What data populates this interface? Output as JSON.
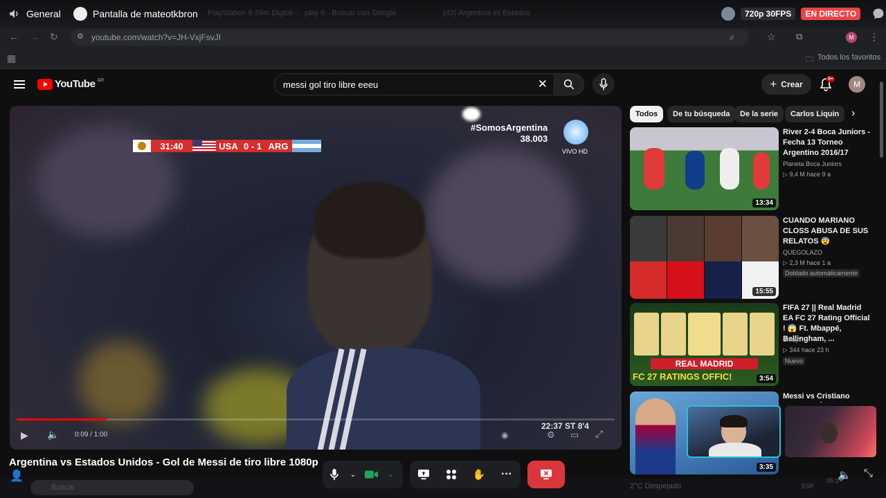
{
  "overlay": {
    "voice_channel": "General",
    "stream_title": "Pantalla de mateotkbron",
    "quality": "720p 30FPS",
    "live_label": "EN DIRECTO"
  },
  "chrome": {
    "tabs": [
      "PlayStation 5 Slim Digital -",
      "play 6 - Buscar con Google",
      "(43) Argentina vs Estados"
    ],
    "url": "youtube.com/watch?v=JH-VxjFsvJI",
    "bookmarks_label": "Todos los favoritos"
  },
  "youtube": {
    "logo": "YouTube",
    "region": "AR",
    "search_query": "messi gol tiro libre eeeu",
    "create_label": "Crear",
    "notif_count": "9+",
    "avatar_letter": "M"
  },
  "video": {
    "scorebug": {
      "time": "31:40",
      "home": "USA",
      "score": "0 - 1",
      "away": "ARG"
    },
    "hashtag": "#SomosArgentina",
    "viewers": "38.003",
    "vivo_label": "VIVO HD",
    "corner_info": "22:37 ST 8'4",
    "player_time": "0:09 / 1:00",
    "title": "Argentina vs Estados Unidos - Gol de Messi de tiro libre 1080p"
  },
  "chips": [
    {
      "label": "Todos",
      "active": true
    },
    {
      "label": "De tu búsqueda",
      "active": false
    },
    {
      "label": "De la serie",
      "active": false
    },
    {
      "label": "Carlos Liquin",
      "active": false
    }
  ],
  "recommendations": [
    {
      "title": "River 2-4 Boca Juniors - Fecha 13 Torneo Argentino 2016/17",
      "channel": "Planeta Boca Juniors",
      "meta": "▷ 9,4 M   hace 9 a",
      "duration": "13:34"
    },
    {
      "title": "CUANDO MARIANO CLOSS ABUSA DE SUS RELATOS 😨",
      "channel": "QUEGOLAZO",
      "meta": "▷ 2,3 M   hace 1 a",
      "tag": "Doblado automáticamente",
      "duration": "15:55"
    },
    {
      "title": "FIFA 27 || Real Madrid EA FC 27 Rating Official ! 😱 Ft. Mbappé, Bellingham, ...",
      "channel": "Binayx",
      "meta": "▷ 344   hace 23 h",
      "tag": "Nuevo",
      "duration": "3:54",
      "banner_top": "REAL MADRID",
      "banner_bottom": "FC 27 RATINGS OFFIC!"
    },
    {
      "title": "Messi vs Cristiano Ronaldo: Éxitos, Batallas",
      "duration": "3:35"
    }
  ],
  "taskbar": {
    "search": "Buscar",
    "weather": "2°C Despejado",
    "lang": "ESP",
    "clock": "05:1"
  }
}
